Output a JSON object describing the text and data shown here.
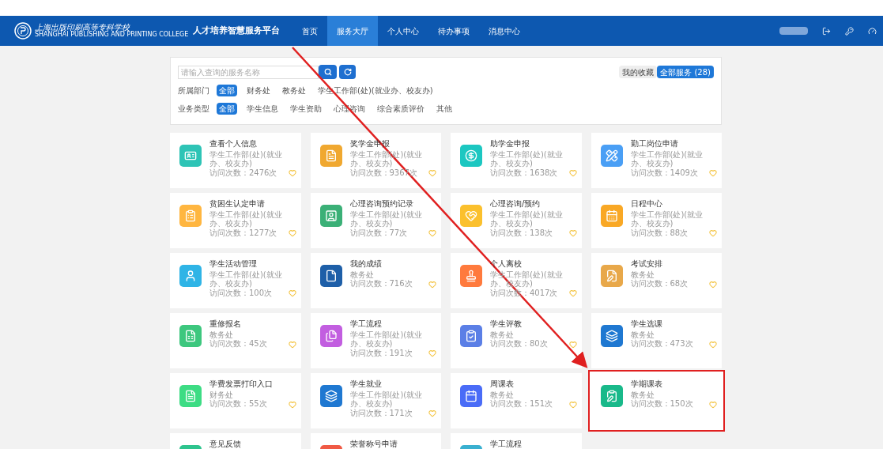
{
  "header": {
    "school_name": "上海出版印刷高等专科学校",
    "school_name_en": "SHANGHAI PUBLISHING AND PRINTING COLLEGE",
    "platform": "人才培养智慧服务平台",
    "nav": [
      {
        "label": "首页",
        "selected": false
      },
      {
        "label": "服务大厅",
        "selected": true
      },
      {
        "label": "个人中心",
        "selected": false
      },
      {
        "label": "待办事项",
        "selected": false
      },
      {
        "label": "消息中心",
        "selected": false
      }
    ]
  },
  "filter": {
    "search": {
      "placeholder": "请输入查询的服务名称"
    },
    "views": [
      {
        "label": "我的收藏",
        "selected": false
      },
      {
        "label": "全部服务 (28)",
        "selected": true
      }
    ],
    "groups": [
      {
        "label": "所属部门",
        "options": [
          {
            "label": "全部",
            "selected": true
          },
          {
            "label": "财务处",
            "selected": false
          },
          {
            "label": "教务处",
            "selected": false
          },
          {
            "label": "学生工作部(处)(就业办、校友办)",
            "selected": false
          }
        ]
      },
      {
        "label": "业务类型",
        "options": [
          {
            "label": "全部",
            "selected": true
          },
          {
            "label": "学生信息",
            "selected": false
          },
          {
            "label": "学生资助",
            "selected": false
          },
          {
            "label": "心理咨询",
            "selected": false
          },
          {
            "label": "综合素质评价",
            "selected": false
          },
          {
            "label": "其他",
            "selected": false
          }
        ]
      }
    ]
  },
  "services": [
    {
      "title": "查看个人信息",
      "dept": "学生工作部(处)(就业办、校友办)",
      "visits": "访问次数：2476次",
      "color": "#2ec4b6",
      "highlighted": false
    },
    {
      "title": "奖学金申报",
      "dept": "学生工作部(处)(就业办、校友办)",
      "visits": "访问次数：9367次",
      "color": "#f0a830",
      "highlighted": false
    },
    {
      "title": "助学金申报",
      "dept": "学生工作部(处)(就业办、校友办)",
      "visits": "访问次数：1638次",
      "color": "#1cc7c1",
      "highlighted": false
    },
    {
      "title": "勤工岗位申请",
      "dept": "学生工作部(处)(就业办、校友办)",
      "visits": "访问次数：1409次",
      "color": "#4a9ff5",
      "highlighted": false
    },
    {
      "title": "贫困生认定申请",
      "dept": "学生工作部(处)(就业办、校友办)",
      "visits": "访问次数：1277次",
      "color": "#ffb640",
      "highlighted": false
    },
    {
      "title": "心理咨询预约记录",
      "dept": "学生工作部(处)(就业办、校友办)",
      "visits": "访问次数：77次",
      "color": "#3bb077",
      "highlighted": false
    },
    {
      "title": "心理咨询/预约",
      "dept": "学生工作部(处)(就业办、校友办)",
      "visits": "访问次数：138次",
      "color": "#fbc02d",
      "highlighted": false
    },
    {
      "title": "日程中心",
      "dept": "学生工作部(处)(就业办、校友办)",
      "visits": "访问次数：88次",
      "color": "#f9a825",
      "highlighted": false
    },
    {
      "title": "学生活动管理",
      "dept": "学生工作部(处)(就业办、校友办)",
      "visits": "访问次数：100次",
      "color": "#2fb4e6",
      "highlighted": false
    },
    {
      "title": "我的成绩",
      "dept": "教务处",
      "visits": "访问次数：716次",
      "color": "#1e5fa8",
      "highlighted": false
    },
    {
      "title": "个人离校",
      "dept": "学生工作部(处)(就业办、校友办)",
      "visits": "访问次数：4017次",
      "color": "#ff7a3d",
      "highlighted": false
    },
    {
      "title": "考试安排",
      "dept": "教务处",
      "visits": "访问次数：68次",
      "color": "#e8a84a",
      "highlighted": false
    },
    {
      "title": "重修报名",
      "dept": "教务处",
      "visits": "访问次数：45次",
      "color": "#3dc77e",
      "highlighted": false
    },
    {
      "title": "学工流程",
      "dept": "学生工作部(处)(就业办、校友办)",
      "visits": "访问次数：191次",
      "color": "#c25ee0",
      "highlighted": false
    },
    {
      "title": "学生评教",
      "dept": "教务处",
      "visits": "访问次数：80次",
      "color": "#5b7fe6",
      "highlighted": false
    },
    {
      "title": "学生选课",
      "dept": "教务处",
      "visits": "访问次数：473次",
      "color": "#1f78d1",
      "highlighted": false
    },
    {
      "title": "学费发票打印入口",
      "dept": "财务处",
      "visits": "访问次数：55次",
      "color": "#3ddc84",
      "highlighted": false
    },
    {
      "title": "学生就业",
      "dept": "学生工作部(处)(就业办、校友办)",
      "visits": "访问次数：171次",
      "color": "#1f78d1",
      "highlighted": false
    },
    {
      "title": "周课表",
      "dept": "教务处",
      "visits": "访问次数：151次",
      "color": "#4a6cf7",
      "highlighted": false
    },
    {
      "title": "学期课表",
      "dept": "教务处",
      "visits": "访问次数：150次",
      "color": "#19b98a",
      "highlighted": true
    },
    {
      "title": "意见反馈",
      "color": "#2ec48e",
      "highlighted": false
    },
    {
      "title": "荣誉称号申请",
      "color": "#f05a45",
      "highlighted": false
    },
    {
      "title": "学工流程",
      "color": "#3ab0d0",
      "highlighted": false
    }
  ]
}
